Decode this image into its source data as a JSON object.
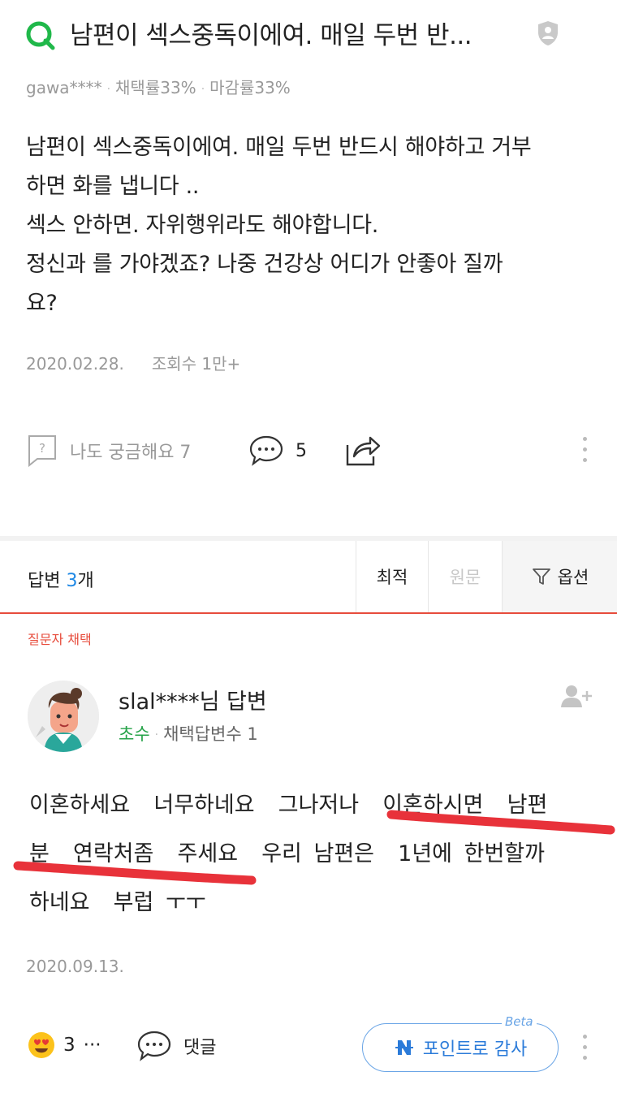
{
  "question": {
    "title": "남편이 섹스중독이에여. 매일 두번 반...",
    "author": "gawa****",
    "adopt_rate": "채택률33%",
    "close_rate": "마감률33%",
    "body": "남편이 섹스중독이에여. 매일 두번 반드시 해야하고 거부\n하면 화를 냅니다 ..\n섹스 안하면. 자위행위라도 해야합니다.\n정신과 를 가야겠죠? 나중 건강상 어디가 안좋아 질까\n요?",
    "date": "2020.02.28.",
    "views": "조회수 1만+",
    "curious_label": "나도 궁금해요 7",
    "comment_count": "5"
  },
  "answers_bar": {
    "label_prefix": "답변 ",
    "count": "3",
    "label_suffix": "개",
    "sort_latest": "최적",
    "sort_original": "원문",
    "options": "옵션"
  },
  "answer": {
    "selected_tag": "질문자 채택",
    "name": "slal****님 답변",
    "level": "초수",
    "adopted_count": "채택답변수 1",
    "body": "이혼하세요  너무하네요  그나저나  이혼하시면  남편\n분  연락처좀  주세요  우리 남편은  1년에 한번할까\n하네요  부럽 ㅜㅜ",
    "date": "2020.09.13.",
    "reaction_count": "3",
    "reaction_more": "···",
    "reply_label": "댓글",
    "point_label": "포인트로 감사",
    "beta_label": "Beta"
  },
  "colors": {
    "accent_green": "#27a34a",
    "accent_blue": "#1e88e5",
    "accent_red": "#e74c3c",
    "underline_red": "#e8323a"
  }
}
